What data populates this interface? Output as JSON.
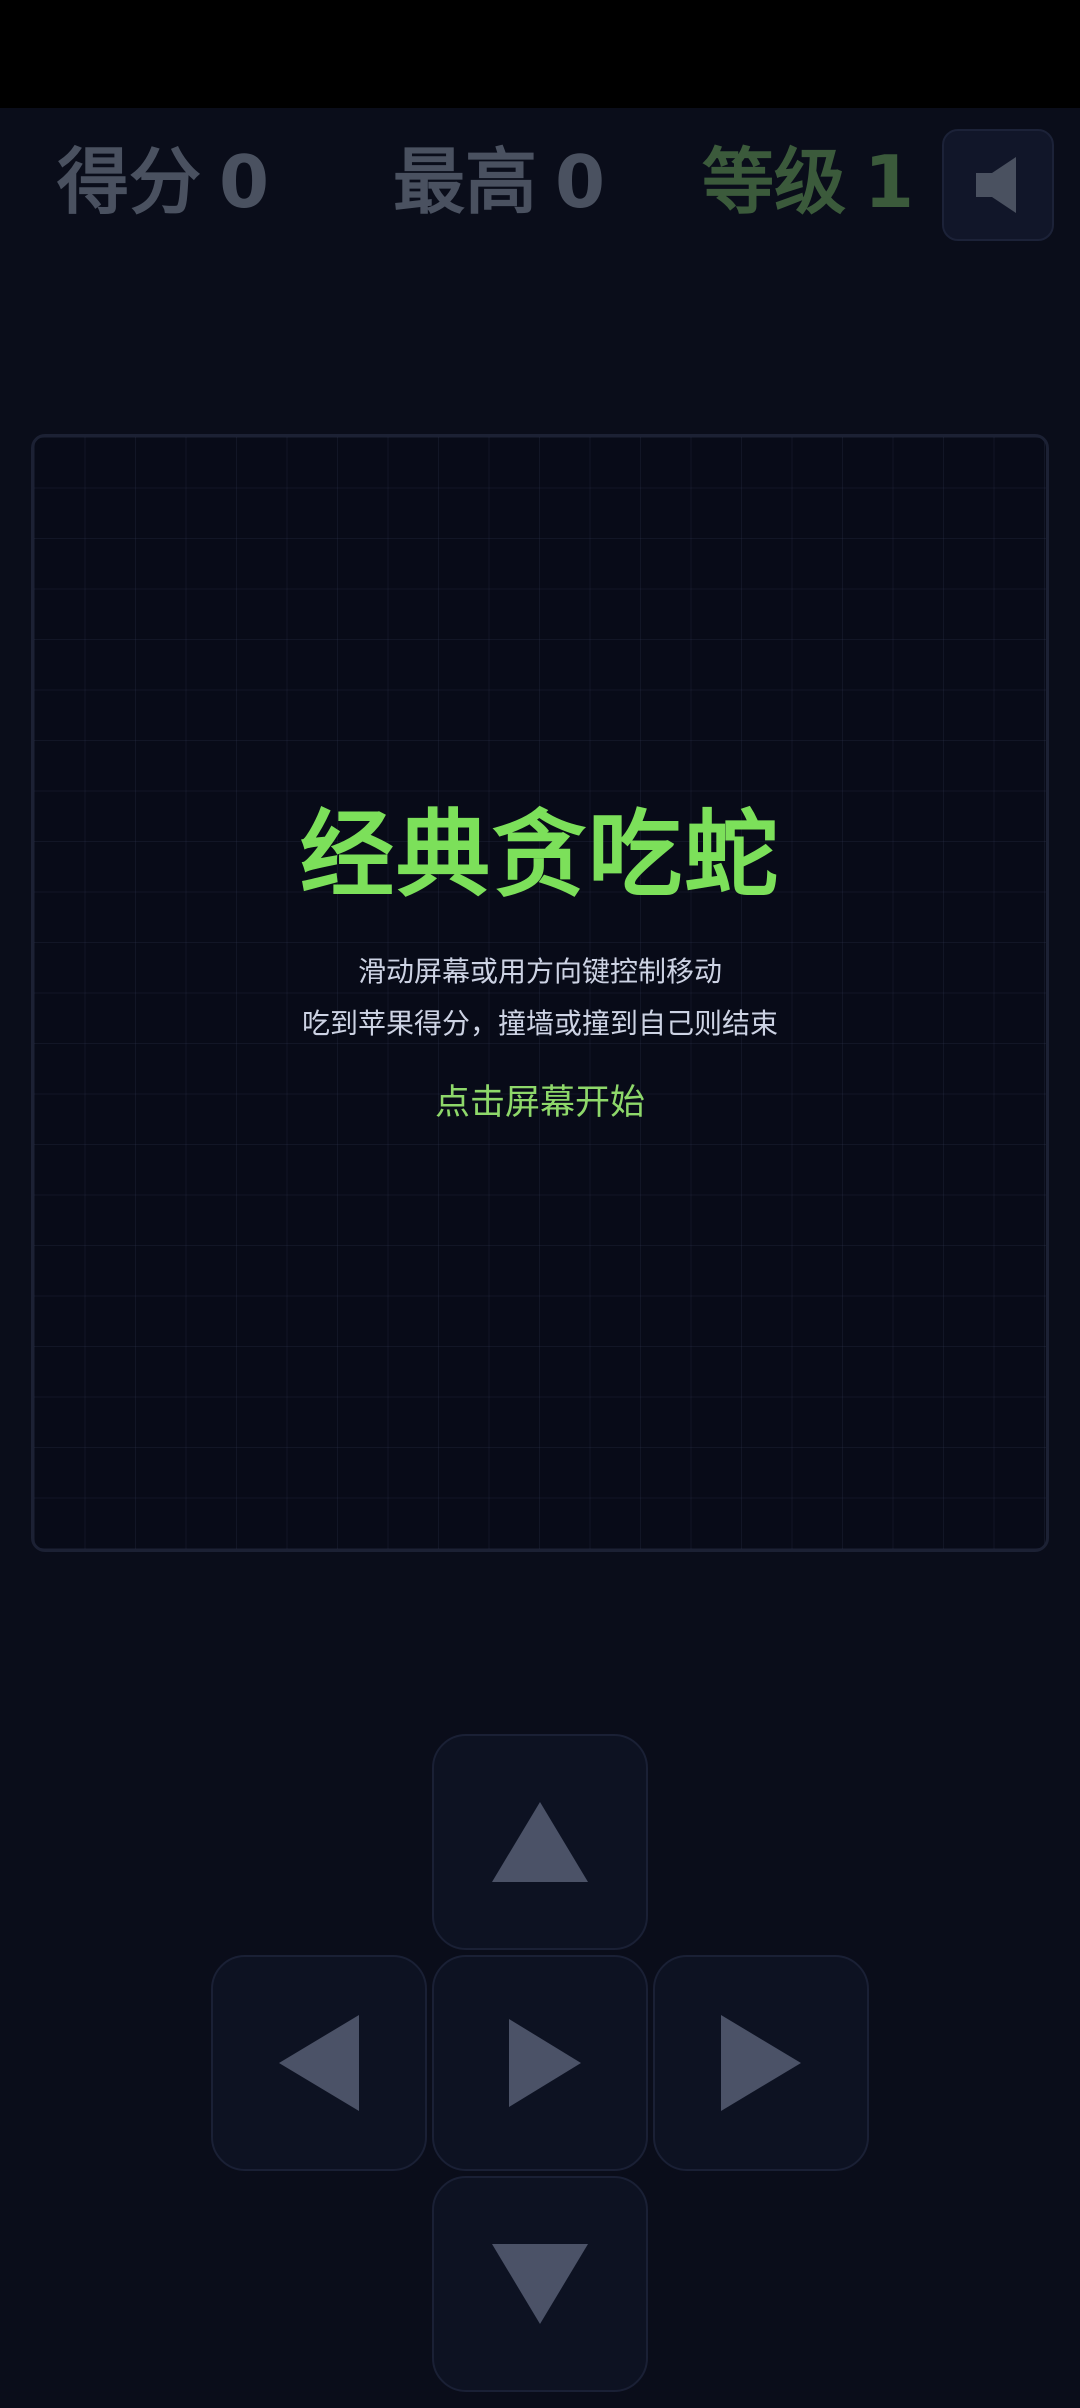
{
  "hud": {
    "score_label": "得分",
    "score_value": "0",
    "best_label": "最高",
    "best_value": "0",
    "level_label": "等级",
    "level_value": "1",
    "sound_icon": "speaker-icon"
  },
  "board": {
    "title": "经典贪吃蛇",
    "instruction_1": "滑动屏幕或用方向键控制移动",
    "instruction_2": "吃到苹果得分，撞墙或撞到自己则结束",
    "start_prompt": "点击屏幕开始"
  },
  "controls": {
    "up_icon": "arrow-up-icon",
    "left_icon": "arrow-left-icon",
    "center_icon": "play-icon",
    "right_icon": "arrow-right-icon",
    "down_icon": "arrow-down-icon"
  },
  "colors": {
    "background": "#0a0d1a",
    "accent_green": "#7ce05a",
    "hud_gray": "#4a5160",
    "level_green": "#3b5a3b"
  }
}
